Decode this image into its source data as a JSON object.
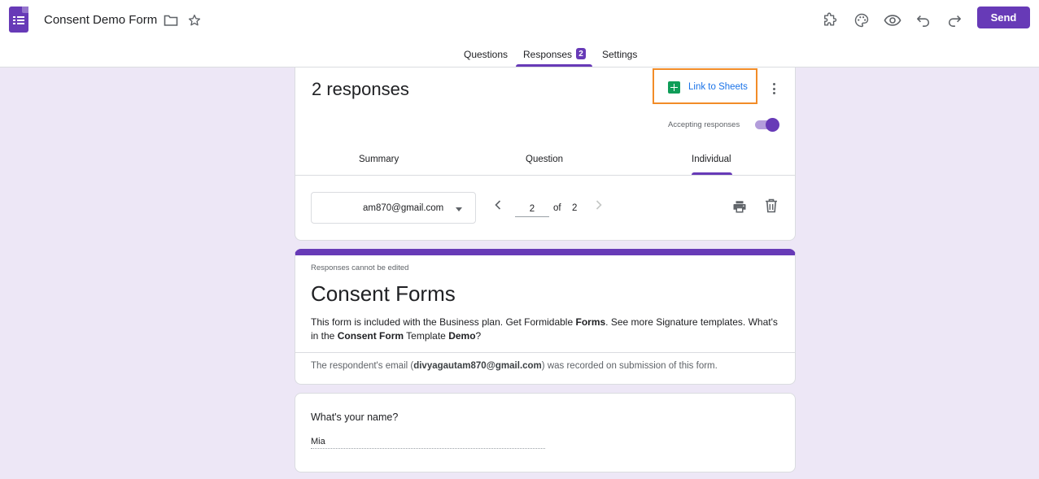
{
  "header": {
    "title": "Consent Demo Form",
    "send_label": "Send",
    "icons": [
      "folder-icon",
      "star-icon",
      "addon-icon",
      "palette-icon",
      "preview-icon",
      "undo-icon",
      "redo-icon"
    ]
  },
  "tabs": {
    "questions": "Questions",
    "responses": "Responses",
    "responses_badge": "2",
    "settings": "Settings"
  },
  "summary": {
    "count_label": "2 responses",
    "link_sheets": "Link to Sheets",
    "accepting_label": "Accepting responses",
    "accepting": true
  },
  "subtabs": {
    "summary": "Summary",
    "question": "Question",
    "individual": "Individual"
  },
  "pager": {
    "selected_email": "am870@gmail.com",
    "current": "2",
    "of_label": "of",
    "total": "2"
  },
  "form": {
    "cannot_edit": "Responses cannot be edited",
    "title": "Consent Forms",
    "desc_1": "This form is included with the Business plan. Get Formidable ",
    "desc_2": "Forms",
    "desc_3": ". See more Signature templates. What's in the ",
    "desc_4": "Consent Form",
    "desc_5": " Template ",
    "desc_6": "Demo",
    "desc_7": "?",
    "email_prefix": "The respondent's email (",
    "email": "divyagautam870@gmail.com",
    "email_suffix": ") was recorded on submission of this form."
  },
  "question": {
    "text": "What's your name?",
    "answer": "Mia"
  },
  "colors": {
    "accent": "#673ab7",
    "background": "#ede7f6",
    "link": "#1a73e8",
    "highlight": "#f28c28",
    "sheets": "#0f9d58"
  }
}
